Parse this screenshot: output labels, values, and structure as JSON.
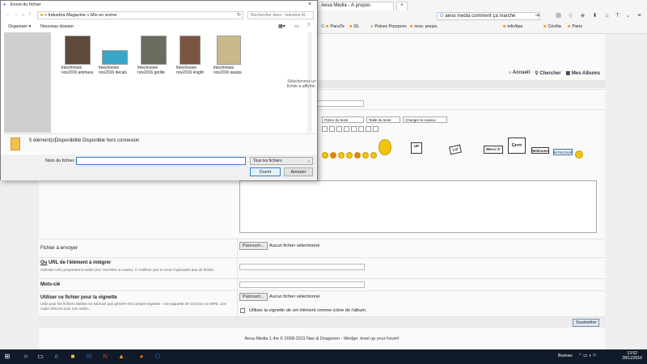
{
  "browser": {
    "tabs": [
      {
        "label": "Aeva Media - À propos"
      }
    ],
    "address": "aeva media comment ça marche",
    "bookmarks": [
      "ParaTe",
      "DL",
      "Poires Pourpres",
      "ress. prepa.",
      "info/tips",
      "Cécilia",
      "Paris"
    ],
    "bookmark_icons": [
      "folder-icon",
      "pear-icon",
      "folder-icon",
      "folder-icon",
      "folder-icon",
      "folder-icon",
      "folder-icon"
    ]
  },
  "forum": {
    "nav": {
      "home": "Accueil",
      "search": "Chercher",
      "albums": "Mes Albums"
    },
    "selects": {
      "font": "Police du texte",
      "size": "Taille du texte",
      "color": "Changer la couleur"
    },
    "signs": [
      "UP",
      "Lol",
      "Merci !!!",
      "Grrrr",
      "Welcome",
      "BONJOUR"
    ],
    "file_to_send": {
      "label": "Fichier à envoyer",
      "button": "Parcourir...",
      "status": "Aucun fichier sélectionné."
    },
    "url": {
      "label_prefix": "Ou",
      "label": "URL de l'élément à intégrer",
      "hint": "Adresse URL proposant la vidéo (sur YouTube ou autre). À n'utiliser que si vous n'uploadez pas de fichier."
    },
    "keywords": {
      "label": "Mots-clé"
    },
    "thumbnail": {
      "label": "Utiliser ce fichier pour la vignette",
      "hint": "Utile pour les fichiers lisibles ne sachant pas générer leur propre vignette - une jaquette de CD pour un MP3, une copie d'écran pour une vidéo...",
      "button": "Parcourir...",
      "status": "Aucun fichier sélectionné.",
      "checkbox_label": "Utiliser la vignette de cet élément comme icône de l'album."
    },
    "submit": "Soumettre",
    "footer": "Aeva Media 1.4w © 2008-2011 Nao & Dragooon - Wedge: level up your forum!"
  },
  "dialog": {
    "title": "Envoi du fichier",
    "path": "» Industria Magazine » Mis en scène",
    "search_placeholder": "Rechercher dans : Industria M...",
    "organize": "Organiser",
    "new_folder": "Nouveau dossier",
    "files": [
      {
        "name": "lmechnews nov2016 animaux",
        "color": "#5d4a3a"
      },
      {
        "name": "lmechnews nov2016 decals",
        "color": "#3aa6c8"
      },
      {
        "name": "lmechnews nov2016 gorille",
        "color": "#6b6b5e"
      },
      {
        "name": "lmechnews nov2016 knight",
        "color": "#7a5540"
      },
      {
        "name": "lmechnews nov2016 wasps",
        "color": "#c9b98a"
      }
    ],
    "preview_hint": "Sélectionnez un fichier à afficher.",
    "status_count": "5 élément(s)",
    "status_avail_label": "Disponibilité :",
    "status_avail_value": "Disponible hors connexion",
    "filename_label": "Nom du fichier :",
    "filename_value": "",
    "filter": "Tous les fichiers",
    "open": "Ouvrir",
    "cancel": "Annuler"
  },
  "taskbar": {
    "desktop_label": "Bureau",
    "time": "13:52",
    "date": "28/11/2016"
  }
}
